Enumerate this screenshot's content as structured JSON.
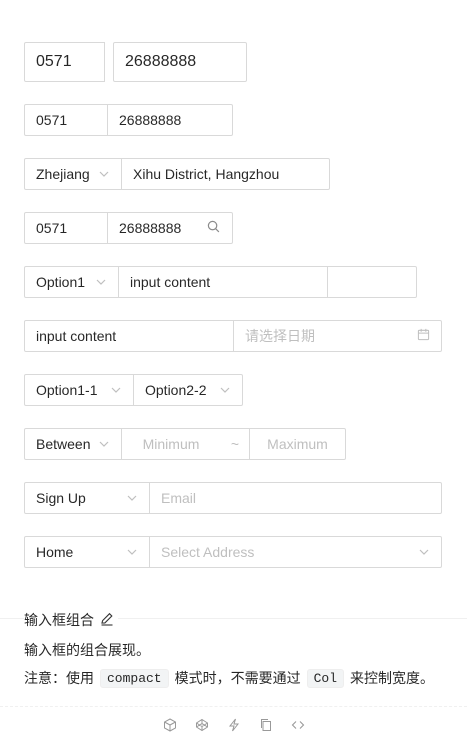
{
  "rows": {
    "r1": {
      "area": "0571",
      "phone": "26888888"
    },
    "r2": {
      "area": "0571",
      "phone": "26888888"
    },
    "r3": {
      "province": "Zhejiang",
      "address": "Xihu District, Hangzhou"
    },
    "r4": {
      "area": "0571",
      "phone": "26888888"
    },
    "r5": {
      "option": "Option1",
      "input": "input content",
      "extra": ""
    },
    "r6": {
      "input": "input content",
      "date_placeholder": "请选择日期"
    },
    "r7": {
      "option1": "Option1-1",
      "option2": "Option2-2"
    },
    "r8": {
      "select": "Between",
      "min_placeholder": "Minimum",
      "sep": "~",
      "max_placeholder": "Maximum"
    },
    "r9": {
      "select": "Sign Up",
      "email_placeholder": "Email"
    },
    "r10": {
      "select": "Home",
      "address_placeholder": "Select Address"
    }
  },
  "section": {
    "title": "输入框组合",
    "desc1": "输入框的组合展现。",
    "desc2_prefix": "注意：使用",
    "desc2_code1": "compact",
    "desc2_middle": "模式时，不需要通过",
    "desc2_code2": "Col",
    "desc2_suffix": "来控制宽度。"
  },
  "icons": {
    "edit": "edit-icon",
    "search": "search-icon",
    "calendar": "calendar-icon",
    "chevron": "chevron-down-icon",
    "actions": [
      "codesandbox-icon",
      "codepen-icon",
      "thunderbolt-icon",
      "copy-icon",
      "code-icon"
    ]
  }
}
